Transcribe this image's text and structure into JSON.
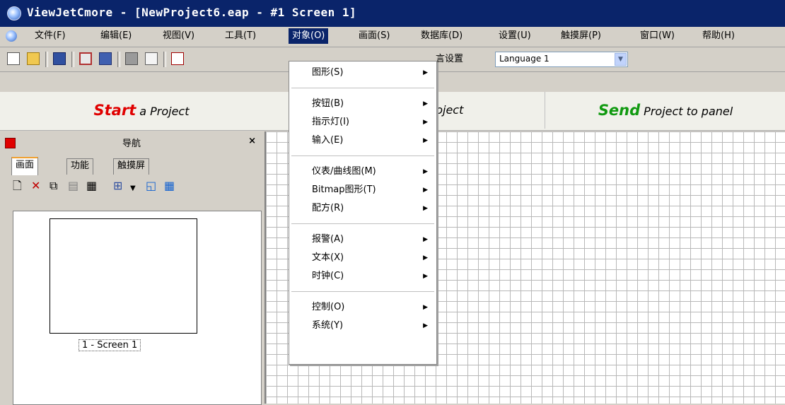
{
  "window": {
    "title": "ViewJetCmore - [NewProject6.eap - #1 Screen 1]"
  },
  "menubar": {
    "items": [
      "文件(F)",
      "编辑(E)",
      "视图(V)",
      "工具(T)",
      "对象(O)",
      "画面(S)",
      "数据库(D)",
      "设置(U)",
      "触摸屏(P)",
      "窗口(W)",
      "帮助(H)"
    ],
    "active": "对象(O)"
  },
  "toolbar": {
    "language_label": "言设置",
    "language_value": "Language 1"
  },
  "actions": {
    "start_big": "Start",
    "start_small": "a Project",
    "project_small": "Project",
    "send_big": "Send",
    "send_small": "Project to panel"
  },
  "nav": {
    "title": "导航",
    "close": "×",
    "tabs": [
      "画面",
      "功能",
      "触摸屏"
    ],
    "screen_label": "1 - Screen 1"
  },
  "object_menu": {
    "items": [
      "图形(S)",
      "按钮(B)",
      "指示灯(I)",
      "输入(E)",
      "仪表/曲线图(M)",
      "Bitmap图形(T)",
      "配方(R)",
      "报警(A)",
      "文本(X)",
      "时钟(C)",
      "控制(O)",
      "系统(Y)"
    ],
    "submenu_arrow": "▶"
  },
  "colors": {
    "titlebar": "#0a246a",
    "start": "#e00000",
    "send": "#119a11",
    "active_tab": "#f0a030"
  }
}
